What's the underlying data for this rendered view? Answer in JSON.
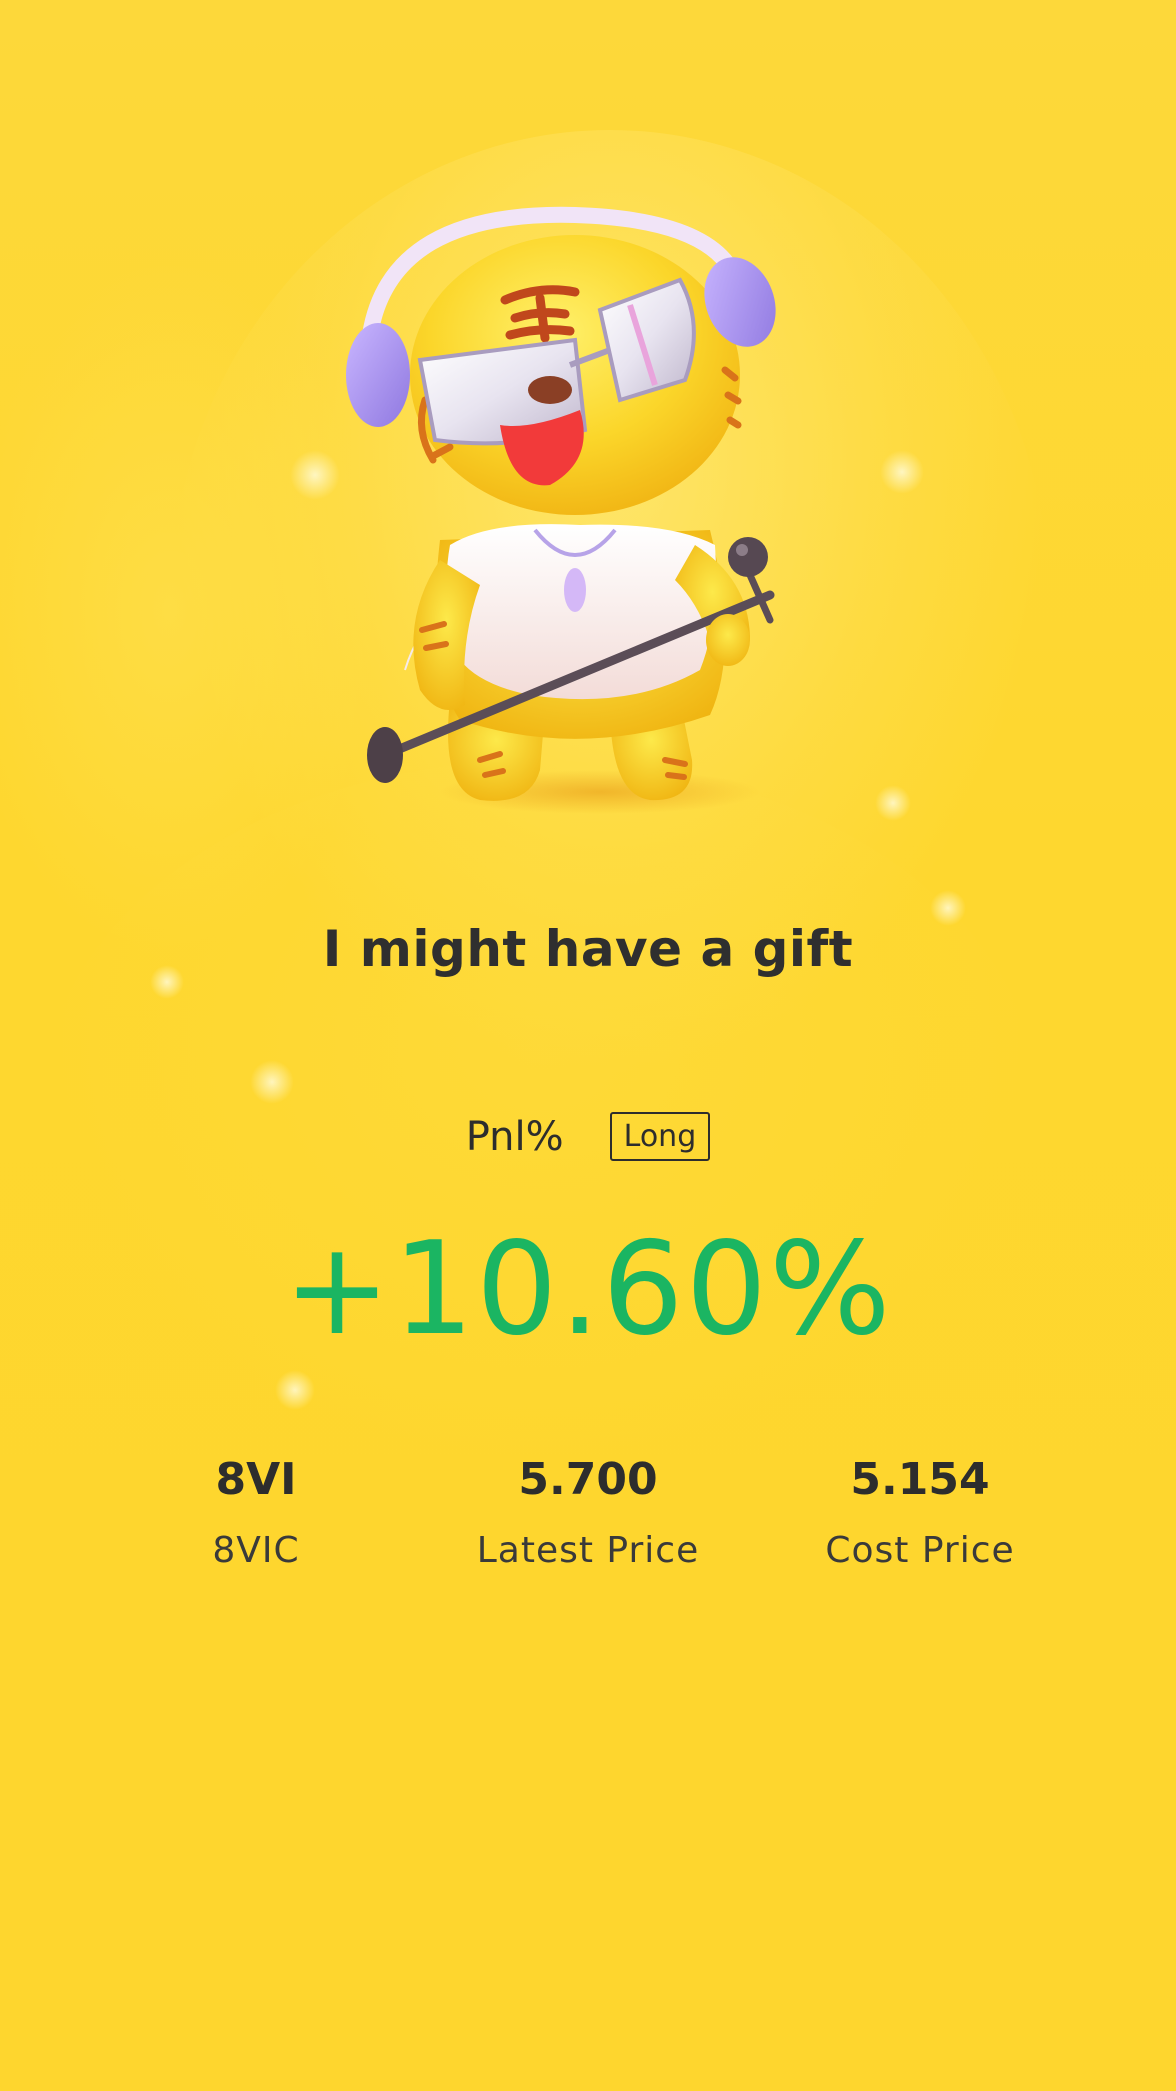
{
  "headline": "I might have a gift",
  "pnl": {
    "label": "Pnl%",
    "direction": "Long",
    "value": "+10.60%",
    "value_color": "#1bb562"
  },
  "stats": [
    {
      "value": "8VI",
      "label": "8VIC"
    },
    {
      "value": "5.700",
      "label": "Latest Price"
    },
    {
      "value": "5.154",
      "label": "Cost Price"
    }
  ],
  "colors": {
    "background": "#fed72f",
    "text": "#2d2d2d",
    "positive": "#1bb562"
  },
  "mascot": "tiger-mascot-with-headphones-and-microphone"
}
